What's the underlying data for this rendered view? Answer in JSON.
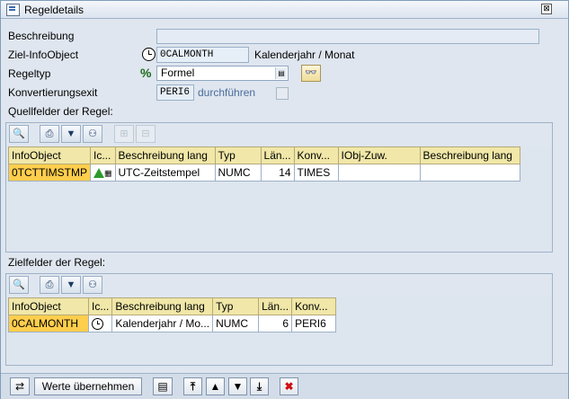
{
  "window": {
    "title": "Regeldetails",
    "close": "⊠"
  },
  "form": {
    "beschreibung_label": "Beschreibung",
    "beschreibung_value": "",
    "ziel_label": "Ziel-InfoObject",
    "ziel_value": "0CALMONTH",
    "ziel_text": "Kalenderjahr / Monat",
    "regeltyp_label": "Regeltyp",
    "regeltyp_value": "Formel",
    "konv_label": "Konvertierungsexit",
    "konv_value": "PERI6",
    "konv_action": "durchführen"
  },
  "quell": {
    "title": "Quellfelder der Regel:",
    "columns": [
      "InfoObject",
      "Ic...",
      "Beschreibung lang",
      "Typ",
      "Län...",
      "Konv...",
      "IObj-Zuw.",
      "Beschreibung lang"
    ],
    "rows": [
      {
        "infoobject": "0TCTTIMSTMP",
        "beschreibung": "UTC-Zeitstempel",
        "typ": "NUMC",
        "laenge": "14",
        "konv": "TIMES",
        "iobj": "",
        "beschreibung2": ""
      }
    ]
  },
  "ziel": {
    "title": "Zielfelder der Regel:",
    "columns": [
      "InfoObject",
      "Ic...",
      "Beschreibung lang",
      "Typ",
      "Län...",
      "Konv..."
    ],
    "rows": [
      {
        "infoobject": "0CALMONTH",
        "beschreibung": "Kalenderjahr / Mo...",
        "typ": "NUMC",
        "laenge": "6",
        "konv": "PERI6"
      }
    ]
  },
  "footer": {
    "werte_label": "Werte übernehmen"
  },
  "colors": {
    "key_cell": "#ffce4d",
    "header_cell": "#f0e7a8",
    "background": "#dfe6ef"
  },
  "icons": [
    "clock-icon",
    "formula-icon",
    "glasses-icon",
    "zoom-icon",
    "print-icon",
    "filter-icon",
    "binoculars-icon",
    "triangle-warning-icon",
    "grid-icon",
    "cancel-icon"
  ]
}
